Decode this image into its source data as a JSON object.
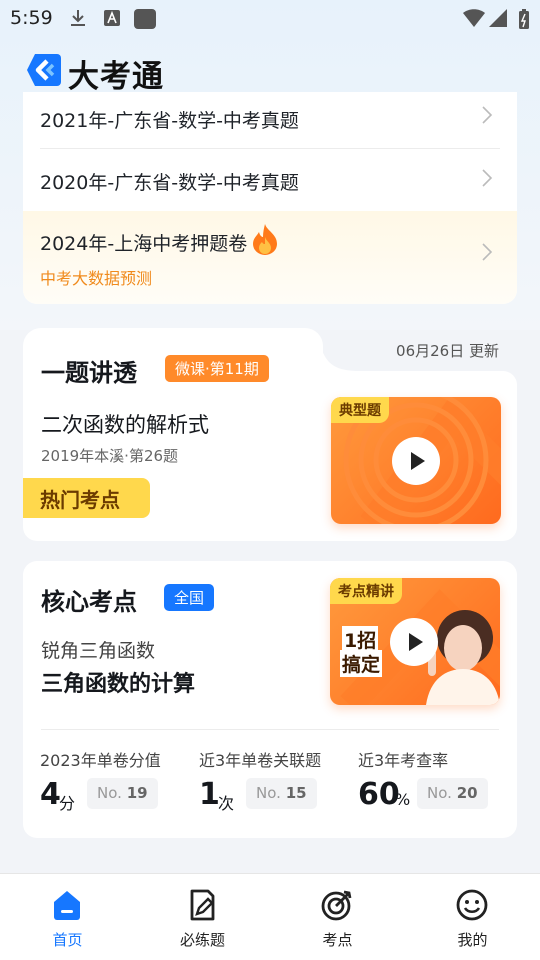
{
  "status_bar": {
    "time": "5:59",
    "icons": [
      "download-icon",
      "a-box-icon",
      "app-square-icon",
      "wifi-icon",
      "signal-icon",
      "battery-icon"
    ]
  },
  "header": {
    "app_name": "大考通",
    "logo": "logo-icon",
    "brand_color": "#1677ff"
  },
  "exam_list": {
    "items": [
      {
        "title": "2021年-广东省-数学-中考真题"
      },
      {
        "title": "2020年-广东省-数学-中考真题"
      }
    ],
    "promo": {
      "title": "2024年-上海中考押题卷",
      "icon": "fire-icon",
      "subtitle": "中考大数据预测"
    }
  },
  "lecture": {
    "section_title": "一题讲透",
    "tag": "微课·第11期",
    "update": "06月26日 更新",
    "question_title": "二次函数的解析式",
    "question_sub": "2019年本溪·第26题",
    "hot_badge": "热门考点",
    "thumb_tag": "典型题"
  },
  "core": {
    "section_title": "核心考点",
    "tag": "全国",
    "sub_text": "锐角三角函数",
    "main_text": "三角函数的计算",
    "thumb_tag": "考点精讲",
    "thumb_caption_1": "1招",
    "thumb_caption_2": "搞定",
    "stats": [
      {
        "label": "2023年单卷分值",
        "value": "4",
        "unit": "分",
        "rank_prefix": "No.",
        "rank": "19"
      },
      {
        "label": "近3年单卷关联题",
        "value": "1",
        "unit": "次",
        "rank_prefix": "No.",
        "rank": "15"
      },
      {
        "label": "近3年考查率",
        "value": "60",
        "unit": "%",
        "rank_prefix": "No.",
        "rank": "20"
      }
    ]
  },
  "bottom_nav": {
    "items": [
      {
        "label": "首页",
        "icon": "home-icon",
        "active": true
      },
      {
        "label": "必练题",
        "icon": "practice-icon",
        "active": false
      },
      {
        "label": "考点",
        "icon": "target-icon",
        "active": false
      },
      {
        "label": "我的",
        "icon": "smile-icon",
        "active": false
      }
    ]
  }
}
